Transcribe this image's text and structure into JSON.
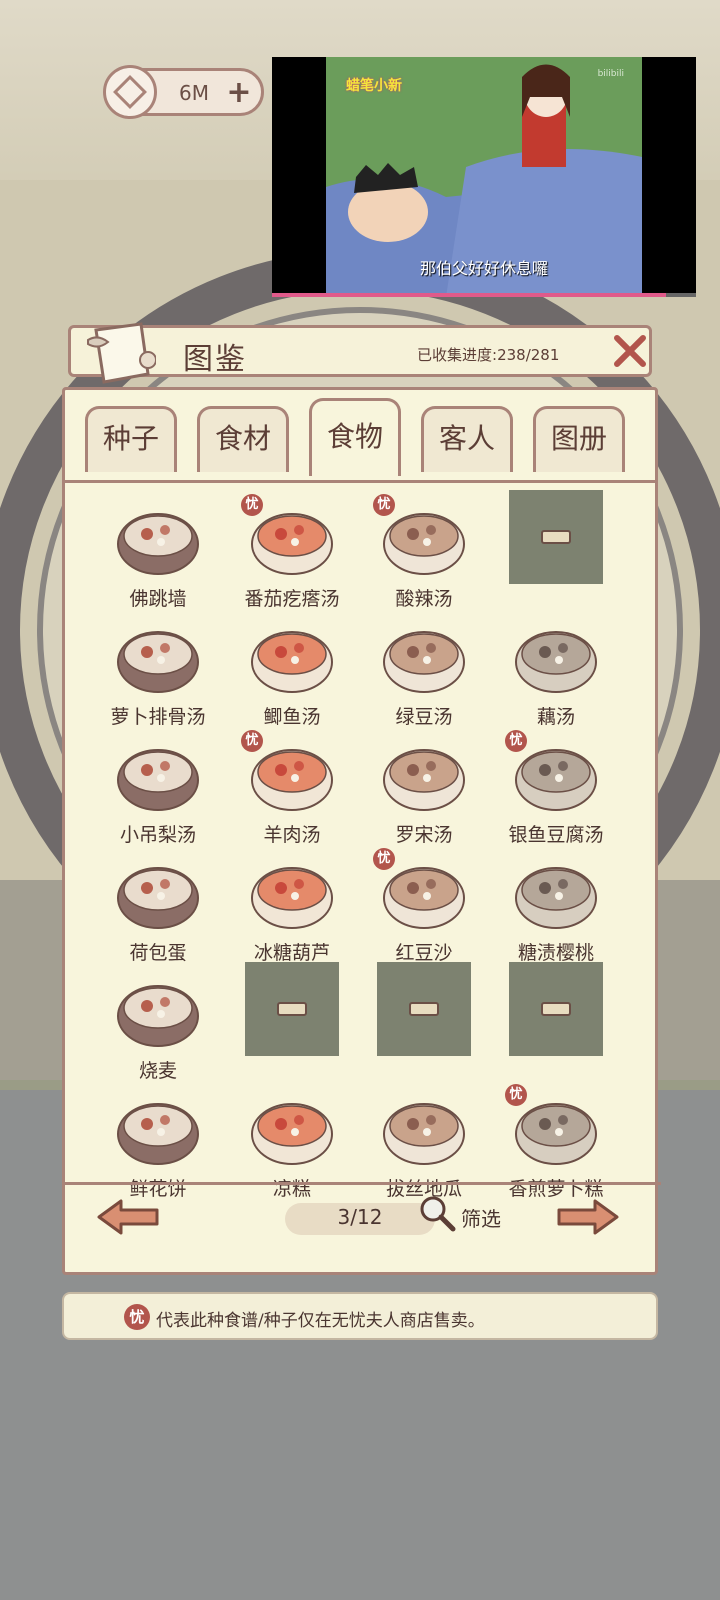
{
  "currency": {
    "amount": "6M",
    "coin_icon": "copper-coin-icon",
    "add_icon": "plus-icon"
  },
  "video": {
    "logo": "蜡笔小新",
    "brand": "bilibili",
    "subtitle": "那伯父好好休息囉",
    "progress": 0.93,
    "progress_color": "#e05a8a"
  },
  "panel": {
    "title": "图鉴",
    "progress_label": "已收集进度:",
    "progress_value": "238/281"
  },
  "tabs": [
    {
      "label": "种子",
      "active": false
    },
    {
      "label": "食材",
      "active": false
    },
    {
      "label": "食物",
      "active": true
    },
    {
      "label": "客人",
      "active": false
    },
    {
      "label": "图册",
      "active": false
    }
  ],
  "items": [
    {
      "label": "佛跳墙",
      "badge": false,
      "locked": false,
      "icon": "fotiaoqiang-dish-icon"
    },
    {
      "label": "番茄疙瘩汤",
      "badge": true,
      "locked": false,
      "icon": "tomato-soup-icon"
    },
    {
      "label": "酸辣汤",
      "badge": true,
      "locked": false,
      "icon": "hot-sour-soup-icon"
    },
    {
      "label": "",
      "badge": false,
      "locked": true,
      "icon": "locked-icon"
    },
    {
      "label": "萝卜排骨汤",
      "badge": false,
      "locked": false,
      "icon": "radish-rib-soup-icon"
    },
    {
      "label": "鲫鱼汤",
      "badge": false,
      "locked": false,
      "icon": "fish-soup-icon"
    },
    {
      "label": "绿豆汤",
      "badge": false,
      "locked": false,
      "icon": "mung-bean-soup-icon"
    },
    {
      "label": "藕汤",
      "badge": false,
      "locked": false,
      "icon": "lotus-root-soup-icon"
    },
    {
      "label": "小吊梨汤",
      "badge": false,
      "locked": false,
      "icon": "pear-soup-icon"
    },
    {
      "label": "羊肉汤",
      "badge": true,
      "locked": false,
      "icon": "mutton-soup-icon"
    },
    {
      "label": "罗宋汤",
      "badge": false,
      "locked": false,
      "icon": "borscht-icon"
    },
    {
      "label": "银鱼豆腐汤",
      "badge": true,
      "locked": false,
      "icon": "tofu-fish-soup-icon"
    },
    {
      "label": "荷包蛋",
      "badge": false,
      "locked": false,
      "icon": "fried-egg-icon"
    },
    {
      "label": "冰糖葫芦",
      "badge": false,
      "locked": false,
      "icon": "candied-haws-icon"
    },
    {
      "label": "红豆沙",
      "badge": true,
      "locked": false,
      "icon": "red-bean-paste-icon"
    },
    {
      "label": "糖渍樱桃",
      "badge": false,
      "locked": false,
      "icon": "candied-cherry-icon"
    },
    {
      "label": "烧麦",
      "badge": false,
      "locked": false,
      "icon": "shaomai-icon"
    },
    {
      "label": "",
      "badge": false,
      "locked": true,
      "icon": "locked-icon"
    },
    {
      "label": "",
      "badge": false,
      "locked": true,
      "icon": "locked-icon"
    },
    {
      "label": "",
      "badge": false,
      "locked": true,
      "icon": "locked-icon"
    },
    {
      "label": "鲜花饼",
      "badge": false,
      "locked": false,
      "icon": "flower-cake-icon"
    },
    {
      "label": "凉糕",
      "badge": false,
      "locked": false,
      "icon": "cold-cake-icon"
    },
    {
      "label": "拔丝地瓜",
      "badge": false,
      "locked": false,
      "icon": "candied-sweet-potato-icon"
    },
    {
      "label": "香煎萝卜糕",
      "badge": true,
      "locked": false,
      "icon": "radish-cake-icon"
    }
  ],
  "badge_glyph": "忧",
  "pager": {
    "page": "3/12",
    "filter_label": "筛选"
  },
  "info": {
    "text": "代表此种食谱/种子仅在无忧夫人商店售卖。"
  }
}
